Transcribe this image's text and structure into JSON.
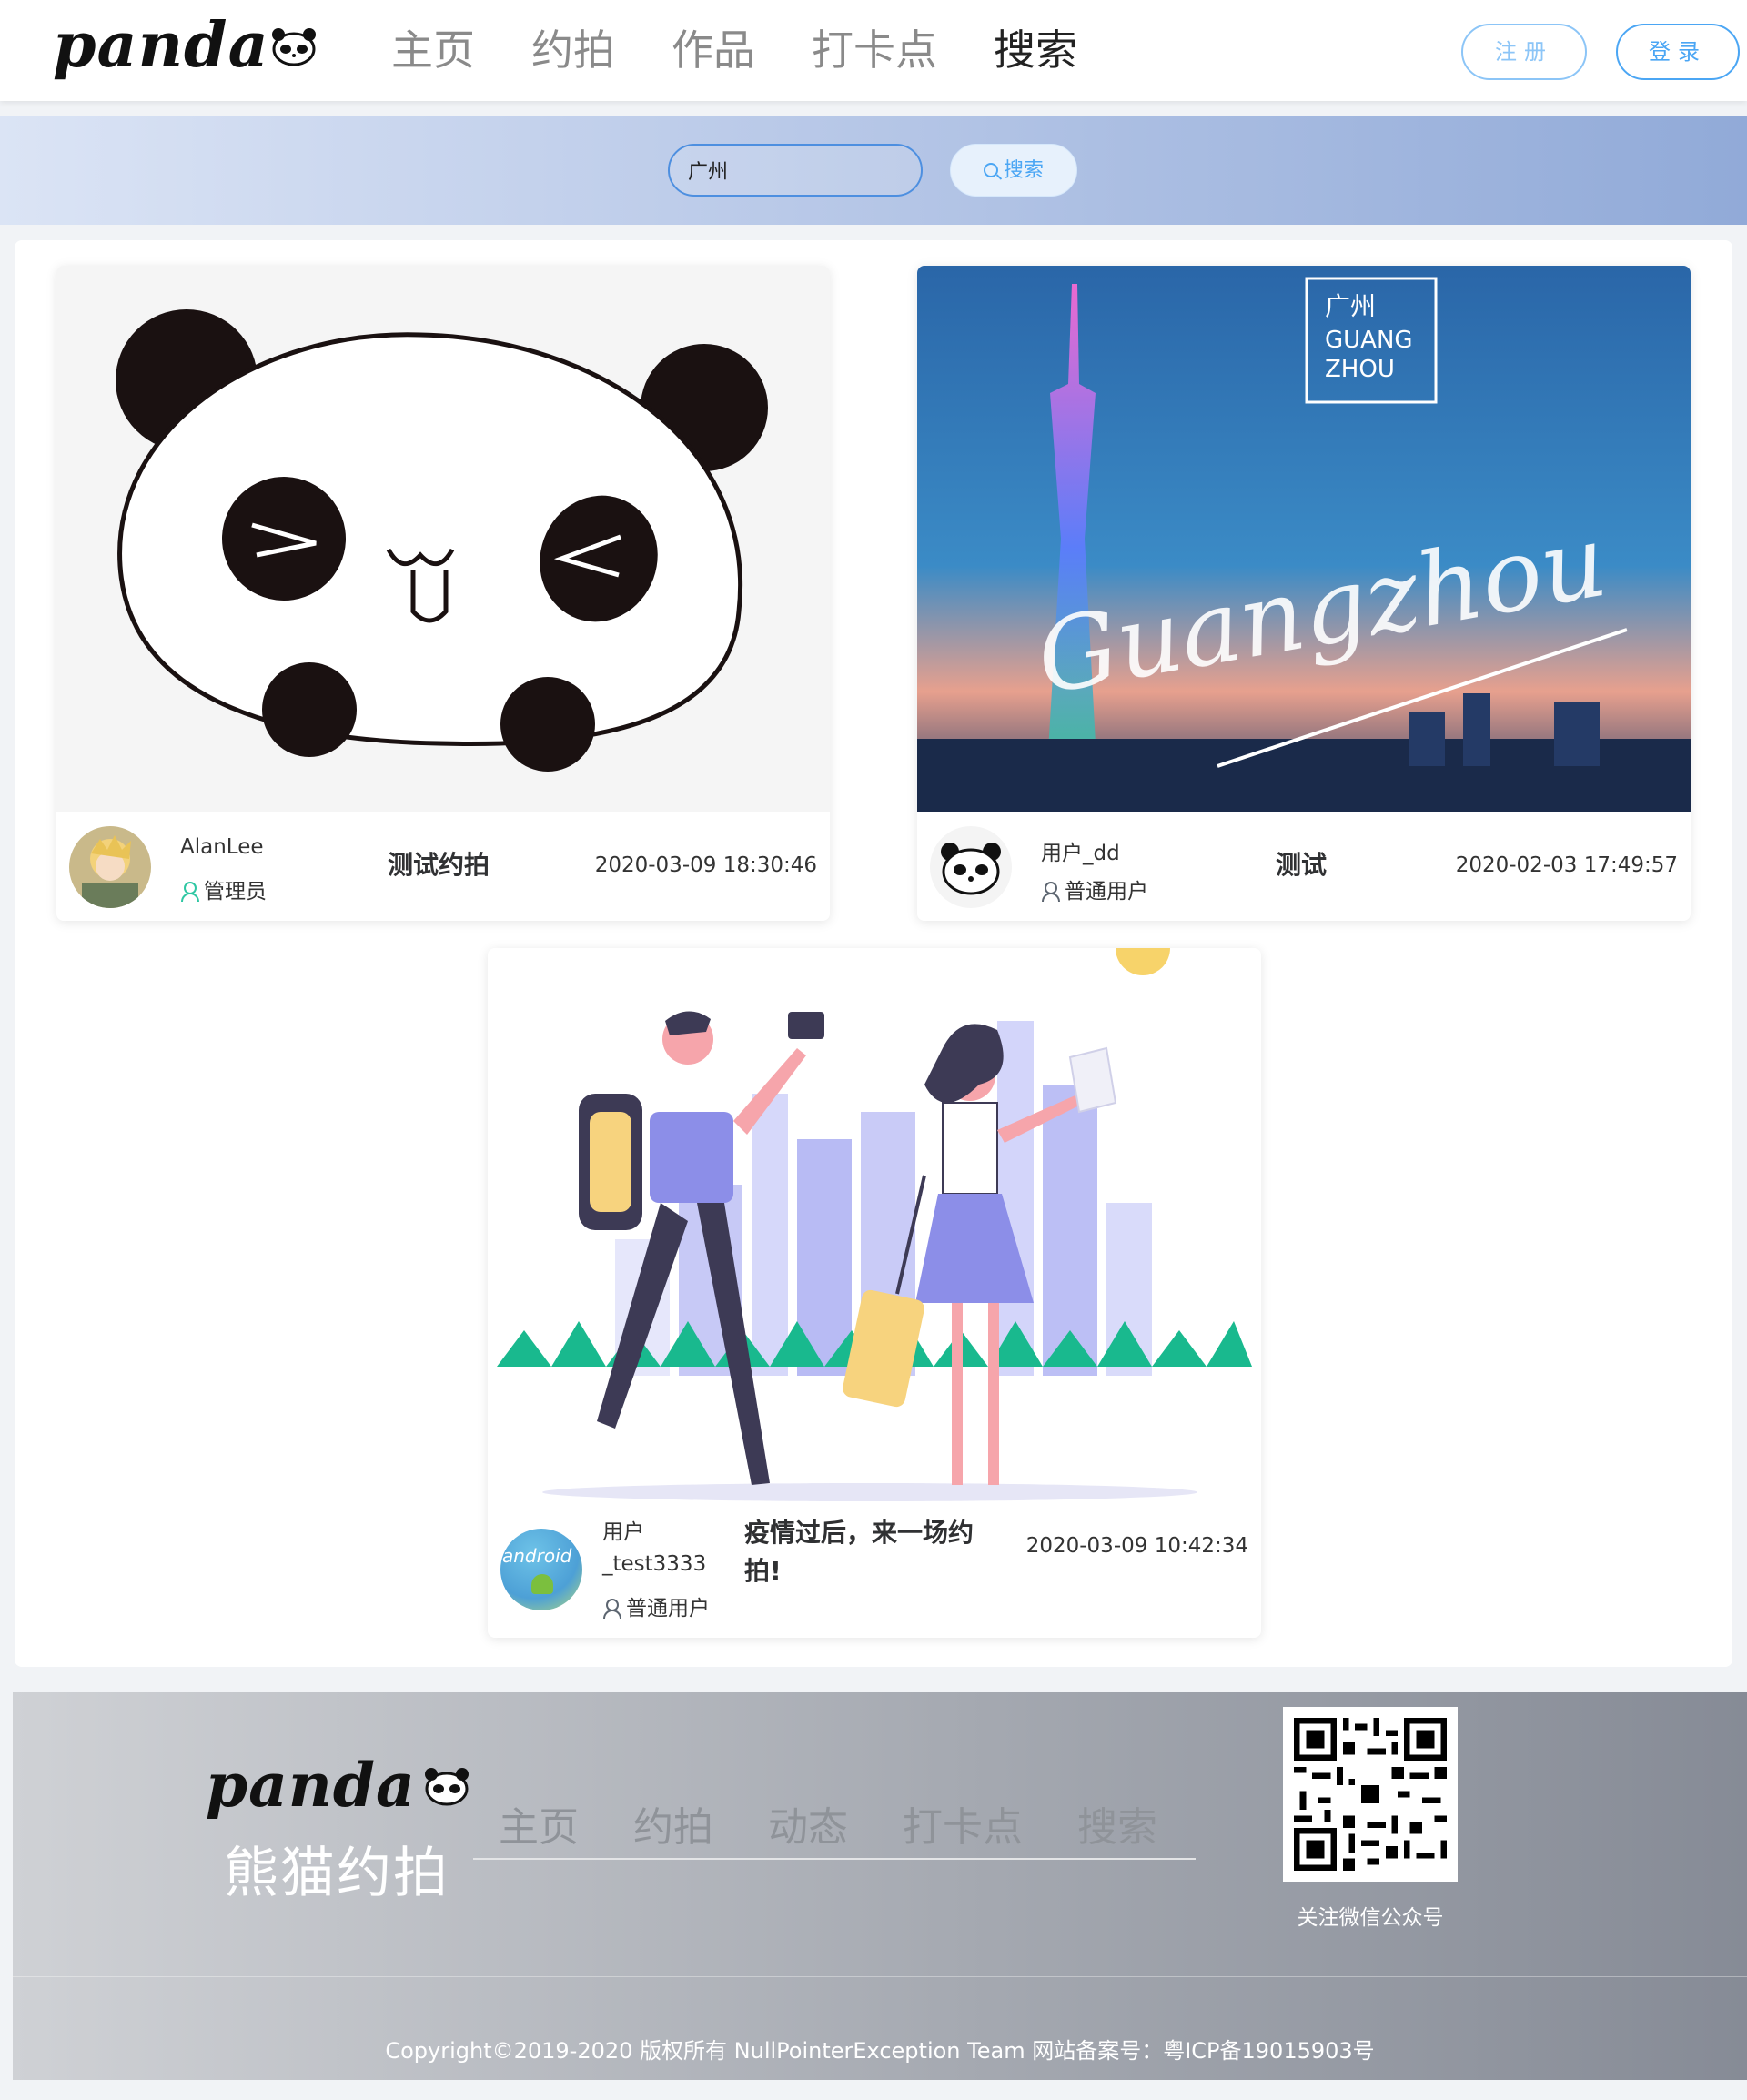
{
  "header": {
    "logo_text": "panda",
    "nav": [
      "主页",
      "约拍",
      "作品",
      "打卡点",
      "搜索"
    ],
    "register_label": "注册",
    "login_label": "登录"
  },
  "search": {
    "value": "广州",
    "button_label": "搜索"
  },
  "cards": [
    {
      "username": "AlanLee",
      "role": "管理员",
      "title": "测试约拍",
      "date": "2020-03-09 18:30:46"
    },
    {
      "username": "用户_dd",
      "role": "普通用户",
      "title": "测试",
      "date": "2020-02-03 17:49:57",
      "image_text": {
        "cn": "广州",
        "en1": "GUANG",
        "en2": "ZHOU",
        "script": "Guangzhou"
      }
    },
    {
      "username_line1": "用户",
      "username_line2": "_test3333",
      "role": "普通用户",
      "title": "疫情过后，来一场约拍!",
      "date": "2020-03-09 10:42:34",
      "avatar_text": "android"
    }
  ],
  "footer": {
    "logo_text": "panda",
    "site_name": "熊猫约拍",
    "nav": [
      "主页",
      "约拍",
      "动态",
      "打卡点",
      "搜索"
    ],
    "qr_label": "关注微信公众号",
    "copyright": "Copyright©2019-2020 版权所有 NullPointerException Team 网站备案号：粤ICP备19015903号"
  },
  "colors": {
    "accent": "#4ba6f4",
    "admin_icon": "#2fc7a3"
  }
}
